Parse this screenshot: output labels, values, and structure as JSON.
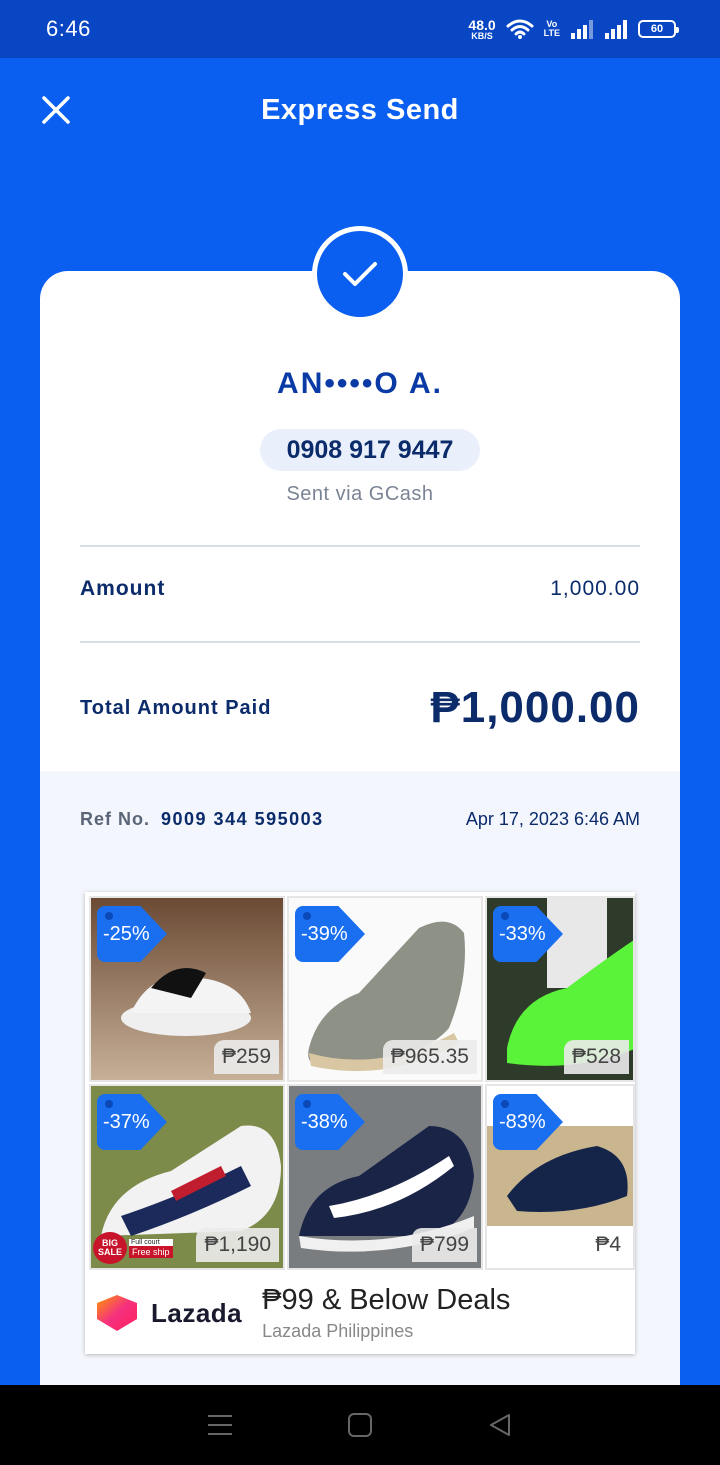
{
  "status_bar": {
    "time": "6:46",
    "net_speed": "48.0",
    "net_unit": "KB/S",
    "volte_top": "Vo",
    "volte_bottom": "LTE",
    "battery": "60"
  },
  "header": {
    "title": "Express Send",
    "close_icon": "close-icon"
  },
  "receipt": {
    "status_icon": "check-icon",
    "recipient_name": "AN••••O A.",
    "phone": "0908 917 9447",
    "sent_via": "Sent via GCash",
    "amount_label": "Amount",
    "amount_value": "1,000.00",
    "total_label": "Total Amount Paid",
    "total_value": "₱1,000.00",
    "ref_label": "Ref No.",
    "ref_number": "9009 344 595003",
    "date": "Apr 17, 2023 6:46 AM"
  },
  "ad": {
    "products": [
      {
        "discount": "-25%",
        "price": "₱259"
      },
      {
        "discount": "-39%",
        "price": "₱965.35"
      },
      {
        "discount": "-33%",
        "price": "₱528"
      },
      {
        "discount": "-37%",
        "price": "₱1,190"
      },
      {
        "discount": "-38%",
        "price": "₱799"
      },
      {
        "discount": "-83%",
        "price": "₱4"
      }
    ],
    "badge": {
      "big": "BIG",
      "sale": "SALE",
      "full_court": "Full court",
      "free_ship": "Free ship"
    },
    "brand": "Lazada",
    "headline": "₱99 & Below Deals",
    "advertiser": "Lazada Philippines"
  },
  "colors": {
    "primary": "#0a5ef0",
    "status_bar": "#0846c4",
    "navy_text": "#0b2b6b",
    "discount_tag": "#1a6ff0"
  },
  "nav": {
    "icons": [
      "menu-icon",
      "home-icon",
      "back-icon"
    ]
  }
}
